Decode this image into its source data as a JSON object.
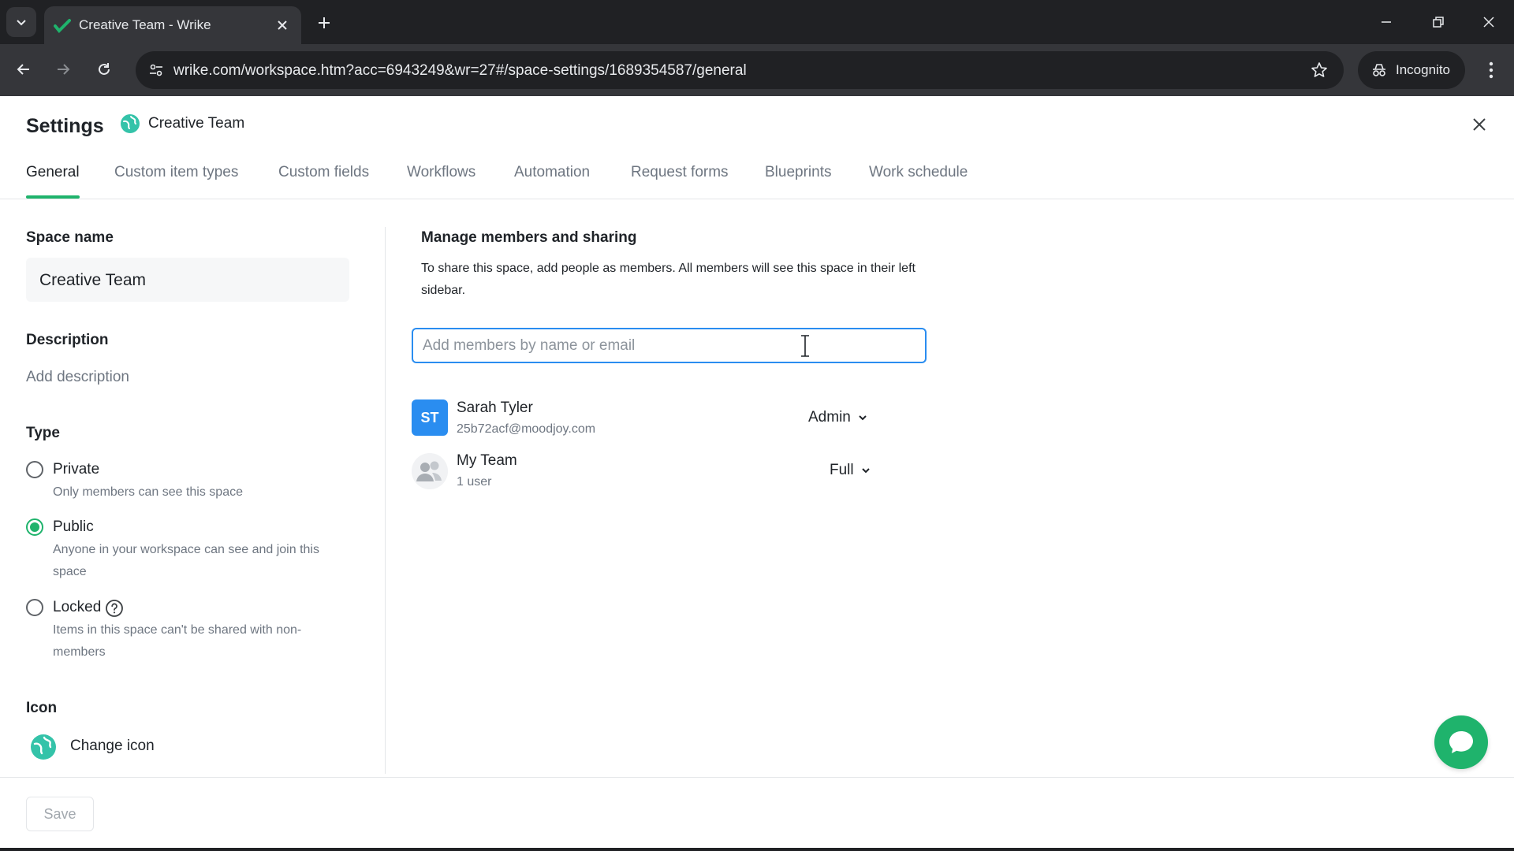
{
  "browser": {
    "tab_title": "Creative Team - Wrike",
    "url": "wrike.com/workspace.htm?acc=6943249&wr=27#/space-settings/1689354587/general",
    "incognito_label": "Incognito"
  },
  "header": {
    "title": "Settings",
    "space_name": "Creative Team"
  },
  "tabs": [
    {
      "label": "General",
      "active": true
    },
    {
      "label": "Custom item types"
    },
    {
      "label": "Custom fields"
    },
    {
      "label": "Workflows"
    },
    {
      "label": "Automation"
    },
    {
      "label": "Request forms"
    },
    {
      "label": "Blueprints"
    },
    {
      "label": "Work schedule"
    }
  ],
  "general": {
    "space_name_label": "Space name",
    "space_name_value": "Creative Team",
    "description_label": "Description",
    "description_placeholder": "Add description",
    "type_label": "Type",
    "type_options": [
      {
        "title": "Private",
        "desc": "Only members can see this space",
        "selected": false
      },
      {
        "title": "Public",
        "desc": "Anyone in your workspace can see and join this space",
        "selected": true
      },
      {
        "title": "Locked",
        "desc": "Items in this space can't be shared with non-members",
        "selected": false
      }
    ],
    "icon_label": "Icon",
    "change_icon_label": "Change icon"
  },
  "members": {
    "title": "Manage members and sharing",
    "description": "To share this space, add people as members. All members will see this space in their left sidebar.",
    "input_placeholder": "Add members by name or email",
    "list": [
      {
        "initials": "ST",
        "name": "Sarah Tyler",
        "sub": "25b72acf@moodjoy.com",
        "role": "Admin"
      },
      {
        "initials": "",
        "name": "My Team",
        "sub": "1 user",
        "role": "Full"
      }
    ]
  },
  "footer": {
    "save_label": "Save"
  },
  "colors": {
    "accent_green": "#1fb36c",
    "focus_blue": "#2a8df0",
    "avatar_blue": "#2a8df0"
  },
  "icons": {
    "space": "globe-planet-icon",
    "chat": "chat-bubble-icon",
    "help": "question-circle-icon"
  }
}
